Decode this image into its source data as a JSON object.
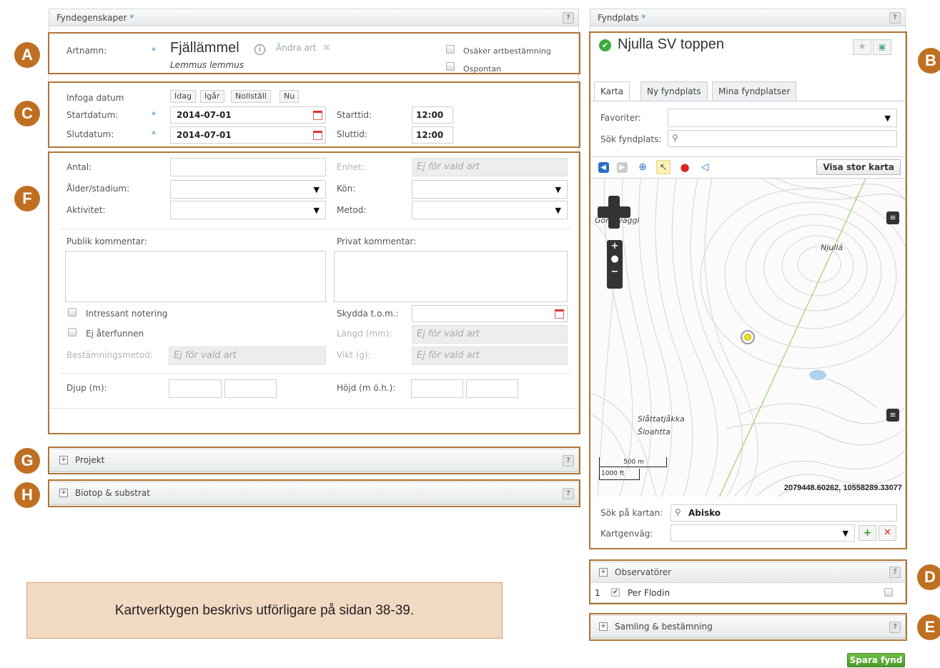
{
  "left_panel": {
    "title": "Fyndegenskaper",
    "required_mark": "*",
    "help": "?"
  },
  "species": {
    "label": "Artnamn:",
    "name": "Fjällämmel",
    "latin": "Lemmus lemmus",
    "change_link": "Ändra art",
    "uncertain_label": "Osäker artbestämning",
    "spontaneous_label": "Ospontan"
  },
  "dates": {
    "insert_label": "Infoga datum",
    "quick_buttons": [
      "Idag",
      "Igår",
      "Nollställ",
      "Nu"
    ],
    "start_label": "Startdatum:",
    "start_value": "2014-07-01",
    "end_label": "Slutdatum:",
    "end_value": "2014-07-01",
    "start_time_label": "Starttid:",
    "start_time_value": "12:00",
    "end_time_label": "Sluttid:",
    "end_time_value": "12:00"
  },
  "details": {
    "count_label": "Antal:",
    "unit_label": "Enhet:",
    "na_text": "Ej för vald art",
    "age_label": "Ålder/stadium:",
    "sex_label": "Kön:",
    "activity_label": "Aktivitet:",
    "method_label": "Metod:",
    "public_comment_label": "Publik kommentar:",
    "private_comment_label": "Privat kommentar:",
    "interesting_label": "Intressant notering",
    "not_found_label": "Ej återfunnen",
    "protected_label": "Skydda t.o.m.:",
    "length_label": "Längd (mm):",
    "determination_label": "Bestämningsmetod:",
    "weight_label": "Vikt (g):",
    "depth_label": "Djup (m):",
    "height_label": "Höjd (m ö.h.):"
  },
  "collapsed_panels": {
    "project": "Projekt",
    "biotope": "Biotop & substrat",
    "observers": "Observatörer",
    "collection": "Samling & bestämning"
  },
  "observers": [
    {
      "num": "1",
      "name": "Per Flodin"
    }
  ],
  "site_panel": {
    "title": "Fyndplats",
    "site_name": "Njulla SV toppen",
    "tabs": [
      "Karta",
      "Ny fyndplats",
      "Mina fyndplatser"
    ],
    "favorites_label": "Favoriter:",
    "search_site_label": "Sök fyndplats:",
    "show_big_map": "Visa stor karta",
    "map_labels": [
      "Gorsaväggi",
      "Njullá",
      "Slåttatjåkka",
      "Šloahtta"
    ],
    "scale_m": "500 m",
    "scale_ft": "1000 ft",
    "coordinates": "2079448.60262, 10558289.33077",
    "search_map_label": "Sök på kartan:",
    "search_map_value": "Abisko",
    "shortcut_label": "Kartgenväg:"
  },
  "callouts": [
    "A",
    "B",
    "C",
    "D",
    "E",
    "F",
    "G",
    "H"
  ],
  "note": "Kartverktygen beskrivs utförligare på sidan 38-39.",
  "save_button": "Spara fynd",
  "colors": {
    "accent": "#bf6f22",
    "highlight_border": "#b07535",
    "note_bg": "#f2d9c2",
    "save_green": "#4e9a2c"
  }
}
